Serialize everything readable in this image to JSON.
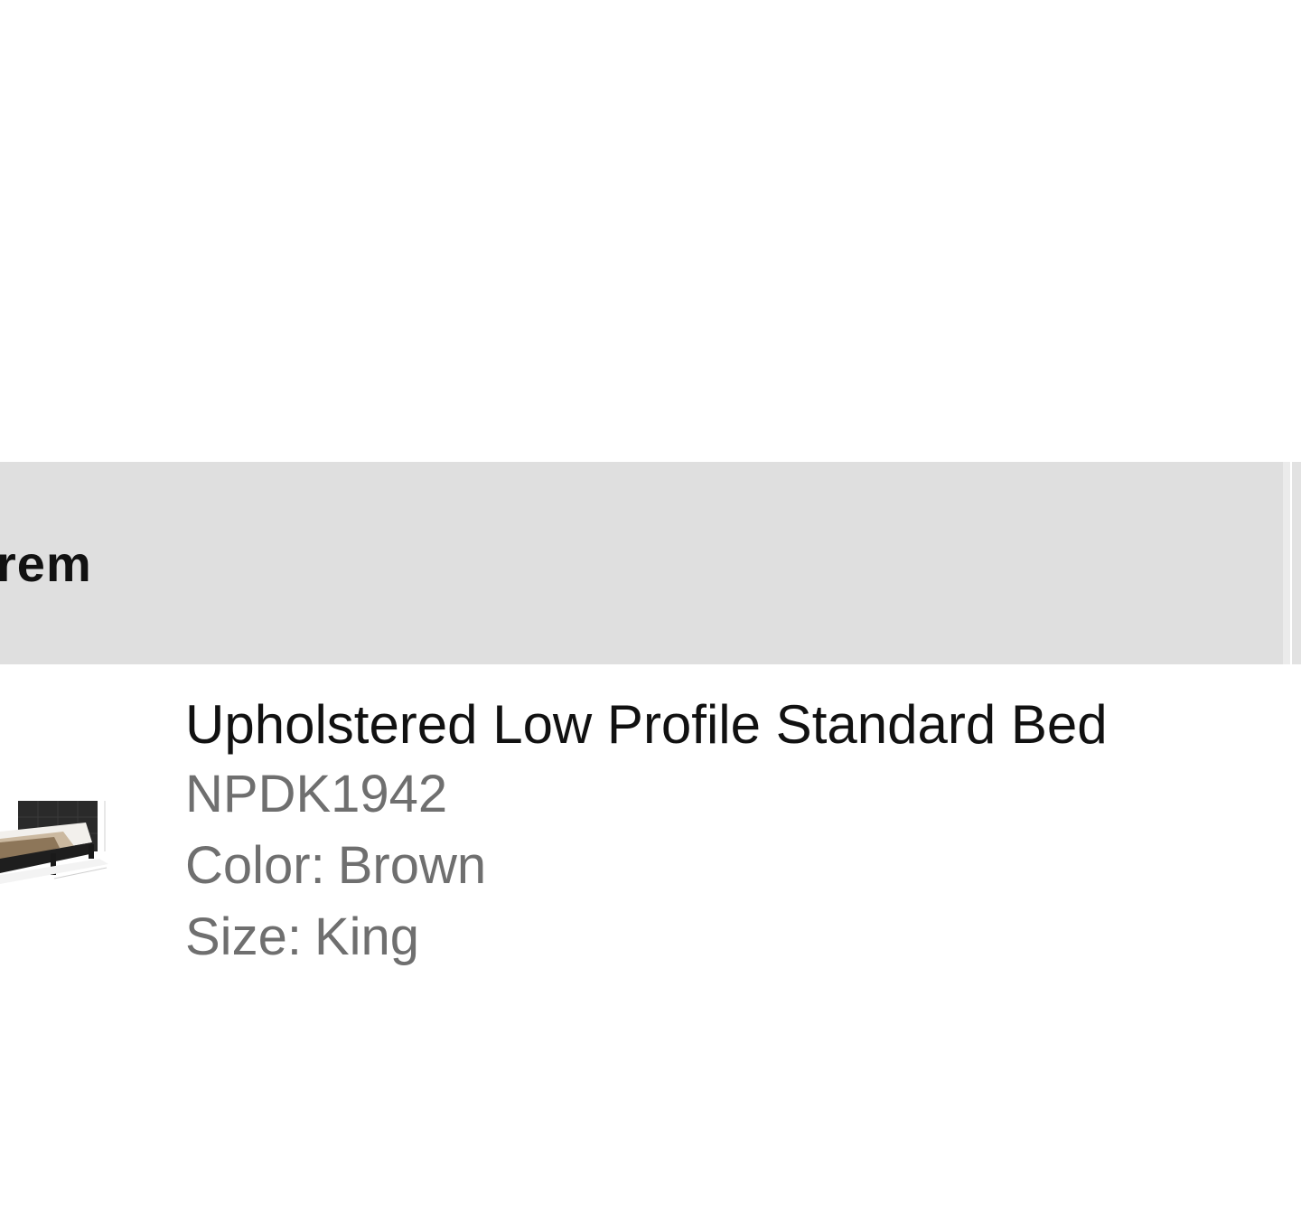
{
  "header": {
    "title": "rem"
  },
  "item": {
    "thumbnail_alt": "bed-thumbnail",
    "name": "Upholstered Low Profile Standard Bed",
    "sku": "NPDK1942",
    "color_label": "Color:",
    "color_value": "Brown",
    "size_label": "Size:",
    "size_value": "King"
  }
}
